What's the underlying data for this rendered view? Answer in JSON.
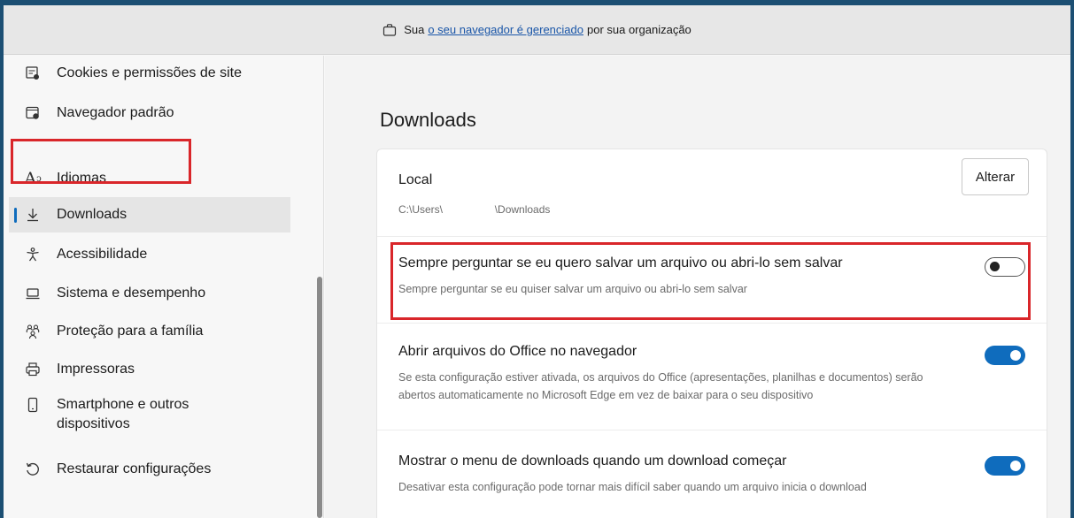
{
  "banner": {
    "prefix": "Sua",
    "link": "o seu navegador é gerenciado",
    "suffix": "por sua organização"
  },
  "sidebar": {
    "items": [
      {
        "label": "Cookies e permissões de site",
        "icon": "cookies-icon"
      },
      {
        "label": "Navegador padrão",
        "icon": "default-browser-icon"
      },
      {
        "label": "Idiomas",
        "icon": "languages-icon"
      },
      {
        "label": "Downloads",
        "icon": "download-icon",
        "active": true
      },
      {
        "label": "Acessibilidade",
        "icon": "accessibility-icon"
      },
      {
        "label": "Sistema e desempenho",
        "icon": "laptop-icon"
      },
      {
        "label": "Proteção para a família",
        "icon": "family-icon"
      },
      {
        "label": "Impressoras",
        "icon": "printer-icon"
      },
      {
        "label": "Smartphone e outros",
        "label2": "dispositivos",
        "icon": "phone-icon"
      },
      {
        "label": "Restaurar configurações",
        "icon": "reset-icon"
      }
    ]
  },
  "main": {
    "title": "Downloads",
    "location": {
      "title": "Local",
      "path_start": "C:\\Users\\",
      "path_end": "\\Downloads",
      "button": "Alterar"
    },
    "settings": [
      {
        "title": "Sempre perguntar se eu quero salvar um arquivo ou abri-lo sem salvar",
        "desc": "Sempre perguntar se eu quiser salvar um arquivo ou abri-lo sem salvar",
        "enabled": false
      },
      {
        "title": "Abrir arquivos do Office no navegador",
        "desc": "Se esta configuração estiver ativada, os arquivos do Office (apresentações, planilhas e documentos) serão",
        "desc2": "abertos automaticamente no Microsoft Edge em vez de baixar para o seu dispositivo",
        "enabled": true
      },
      {
        "title": "Mostrar o menu de downloads quando um download começar",
        "desc": "Desativar esta configuração pode tornar mais difícil saber quando um arquivo inicia o download",
        "enabled": true
      }
    ]
  },
  "colors": {
    "accent": "#0f6cbd",
    "highlight": "#d9262a"
  }
}
